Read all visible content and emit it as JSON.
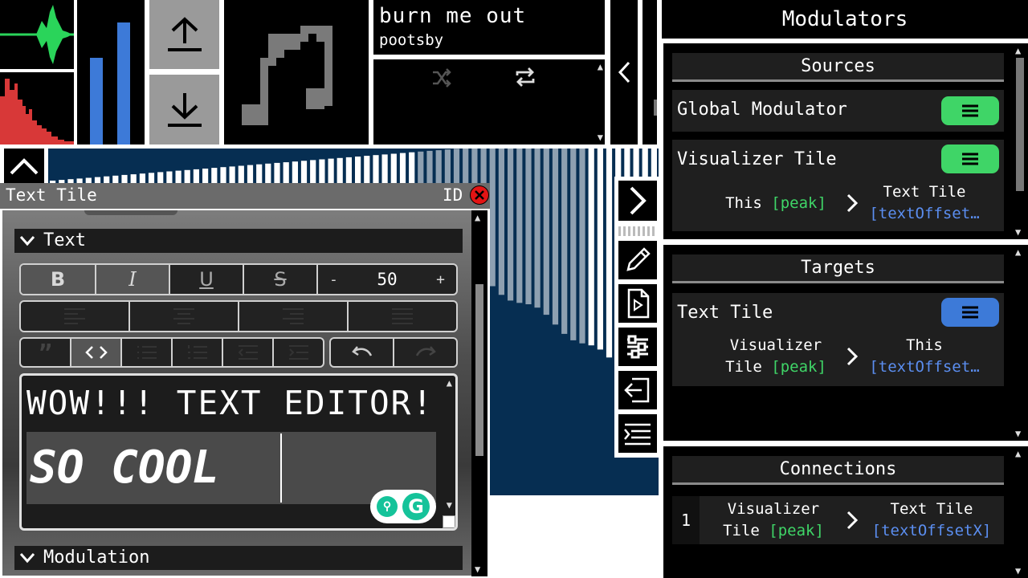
{
  "player": {
    "song_title": "burn me out",
    "artist": "pootsby"
  },
  "text_tile": {
    "title": "Text Tile",
    "id_label": "ID",
    "section_text": "Text",
    "section_modulation": "Modulation",
    "font_size": "50",
    "minus": "-",
    "plus": "+",
    "bold": "B",
    "italic": "I",
    "underline": "U",
    "strike": "S",
    "editor_line1": "WOW!!! TEXT EDITOR!",
    "editor_line2": "SO COOL"
  },
  "modulators": {
    "title": "Modulators",
    "sources": {
      "header": "Sources",
      "items": [
        {
          "name": "Global Modulator"
        },
        {
          "name": "Visualizer Tile",
          "map_from": "This",
          "map_from_prop": "[peak]",
          "map_to": "Text Tile",
          "map_to_prop": "[textOffset…"
        }
      ]
    },
    "targets": {
      "header": "Targets",
      "items": [
        {
          "name": "Text Tile",
          "map_from_1": "Visualizer",
          "map_from_2": "Tile",
          "map_from_prop": "[peak]",
          "map_to": "This",
          "map_to_prop": "[textOffset…"
        }
      ]
    },
    "connections": {
      "header": "Connections",
      "items": [
        {
          "index": "1",
          "from_1": "Visualizer",
          "from_2": "Tile",
          "from_prop": "[peak]",
          "to": "Text Tile",
          "to_prop": "[textOffsetX]"
        }
      ]
    }
  },
  "colors": {
    "accent_green": "#3fd567",
    "accent_blue": "#3d7ad8",
    "visualizer_bg": "#062e52",
    "close_red": "#e31414"
  },
  "icons": [
    "upload-icon",
    "download-icon",
    "music-note-icon",
    "shuffle-icon",
    "repeat-icon",
    "chevron-left-icon",
    "chevron-up-icon",
    "chevron-right-icon",
    "pencil-icon",
    "play-file-icon",
    "sliders-icon",
    "export-icon",
    "list-icon",
    "menu-icon",
    "close-icon",
    "grammarly-icon",
    "bulb-icon"
  ]
}
